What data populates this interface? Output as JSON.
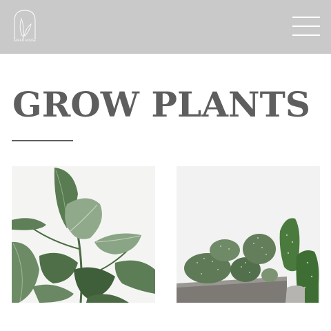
{
  "header": {
    "logo_icon": "plant-leaf-logo",
    "logo_text": "GREEN HOUSE",
    "menu_icon": "hamburger-menu-icon",
    "background": "#c9c9c9"
  },
  "hero": {
    "title": "GROW PLANTS",
    "title_color": "#5e5e5e"
  },
  "gallery": [
    {
      "subject": "rubber plant leaves"
    },
    {
      "subject": "potted cactus"
    }
  ]
}
